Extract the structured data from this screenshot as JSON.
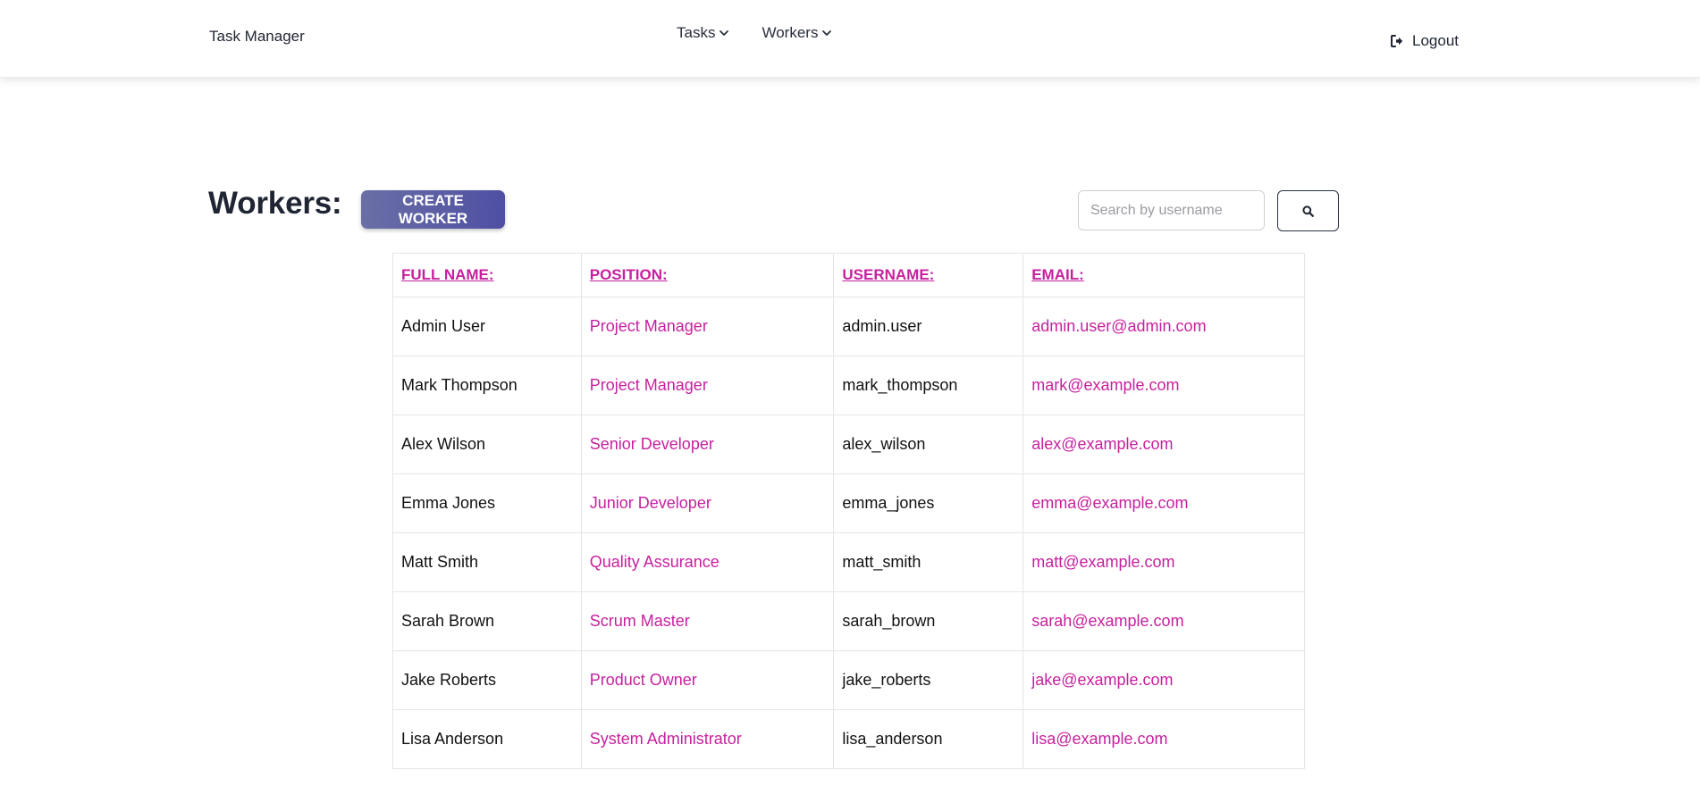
{
  "navbar": {
    "brand": "Task Manager",
    "menu": [
      {
        "label": "Tasks",
        "icon": "chevron-down-icon"
      },
      {
        "label": "Workers",
        "icon": "chevron-down-icon"
      }
    ],
    "logout_label": "Logout",
    "logout_icon": "sign-out-icon"
  },
  "page": {
    "title": "Workers:",
    "create_label": "CREATE WORKER"
  },
  "search": {
    "placeholder": "Search by username",
    "value": "",
    "button_icon": "search-icon"
  },
  "table": {
    "headers": [
      "FULL NAME:",
      "POSITION:",
      "USERNAME:",
      "EMAIL:"
    ],
    "rows": [
      {
        "full_name": "Admin User",
        "position": "Project Manager",
        "username": "admin.user",
        "email": "admin.user@admin.com"
      },
      {
        "full_name": "Mark Thompson",
        "position": "Project Manager",
        "username": "mark_thompson",
        "email": "mark@example.com"
      },
      {
        "full_name": "Alex Wilson",
        "position": "Senior Developer",
        "username": "alex_wilson",
        "email": "alex@example.com"
      },
      {
        "full_name": "Emma Jones",
        "position": "Junior Developer",
        "username": "emma_jones",
        "email": "emma@example.com"
      },
      {
        "full_name": "Matt Smith",
        "position": "Quality Assurance",
        "username": "matt_smith",
        "email": "matt@example.com"
      },
      {
        "full_name": "Sarah Brown",
        "position": "Scrum Master",
        "username": "sarah_brown",
        "email": "sarah@example.com"
      },
      {
        "full_name": "Jake Roberts",
        "position": "Product Owner",
        "username": "jake_roberts",
        "email": "jake@example.com"
      },
      {
        "full_name": "Lisa Anderson",
        "position": "System Administrator",
        "username": "lisa_anderson",
        "email": "lisa@example.com"
      }
    ]
  },
  "colors": {
    "accent_link": "#c7209e",
    "button_gradient_start": "#6a6fa6",
    "button_gradient_end": "#4f4fa3",
    "heading_text": "#1f2533"
  }
}
